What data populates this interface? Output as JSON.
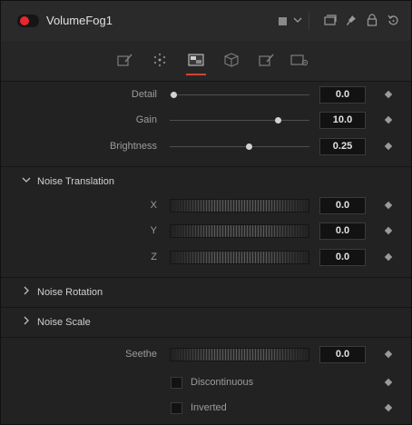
{
  "header": {
    "tool_name": "VolumeFog1",
    "active": true,
    "icons": [
      "color-swatch-icon",
      "chevron-down-icon",
      "version-icon",
      "pin-icon",
      "lock-icon",
      "reset-icon"
    ]
  },
  "tabs": [
    {
      "name": "controls-tab-icon",
      "active": false
    },
    {
      "name": "noise-dots-tab-icon",
      "active": false
    },
    {
      "name": "image-tab-icon",
      "active": true
    },
    {
      "name": "3d-tab-icon",
      "active": false
    },
    {
      "name": "settings-tab-icon",
      "active": false
    },
    {
      "name": "camera-gear-tab-icon",
      "active": false
    }
  ],
  "controls": {
    "detail": {
      "label": "Detail",
      "value": "0.0",
      "slider_fraction": 0.0
    },
    "gain": {
      "label": "Gain",
      "value": "10.0",
      "slider_fraction": 0.77
    },
    "brightness": {
      "label": "Brightness",
      "value": "0.25",
      "slider_fraction": 0.56
    }
  },
  "sections": {
    "noise_translation": {
      "title": "Noise Translation",
      "expanded": true,
      "x": {
        "label": "X",
        "value": "0.0"
      },
      "y": {
        "label": "Y",
        "value": "0.0"
      },
      "z": {
        "label": "Z",
        "value": "0.0"
      }
    },
    "noise_rotation": {
      "title": "Noise Rotation",
      "expanded": false
    },
    "noise_scale": {
      "title": "Noise Scale",
      "expanded": false
    }
  },
  "seethe": {
    "label": "Seethe",
    "value": "0.0"
  },
  "discontinuous": {
    "label": "Discontinuous",
    "checked": false
  },
  "inverted": {
    "label": "Inverted",
    "checked": false
  },
  "colors": {
    "accent": "#d1442f",
    "record": "#e8262d",
    "background": "#222222"
  }
}
